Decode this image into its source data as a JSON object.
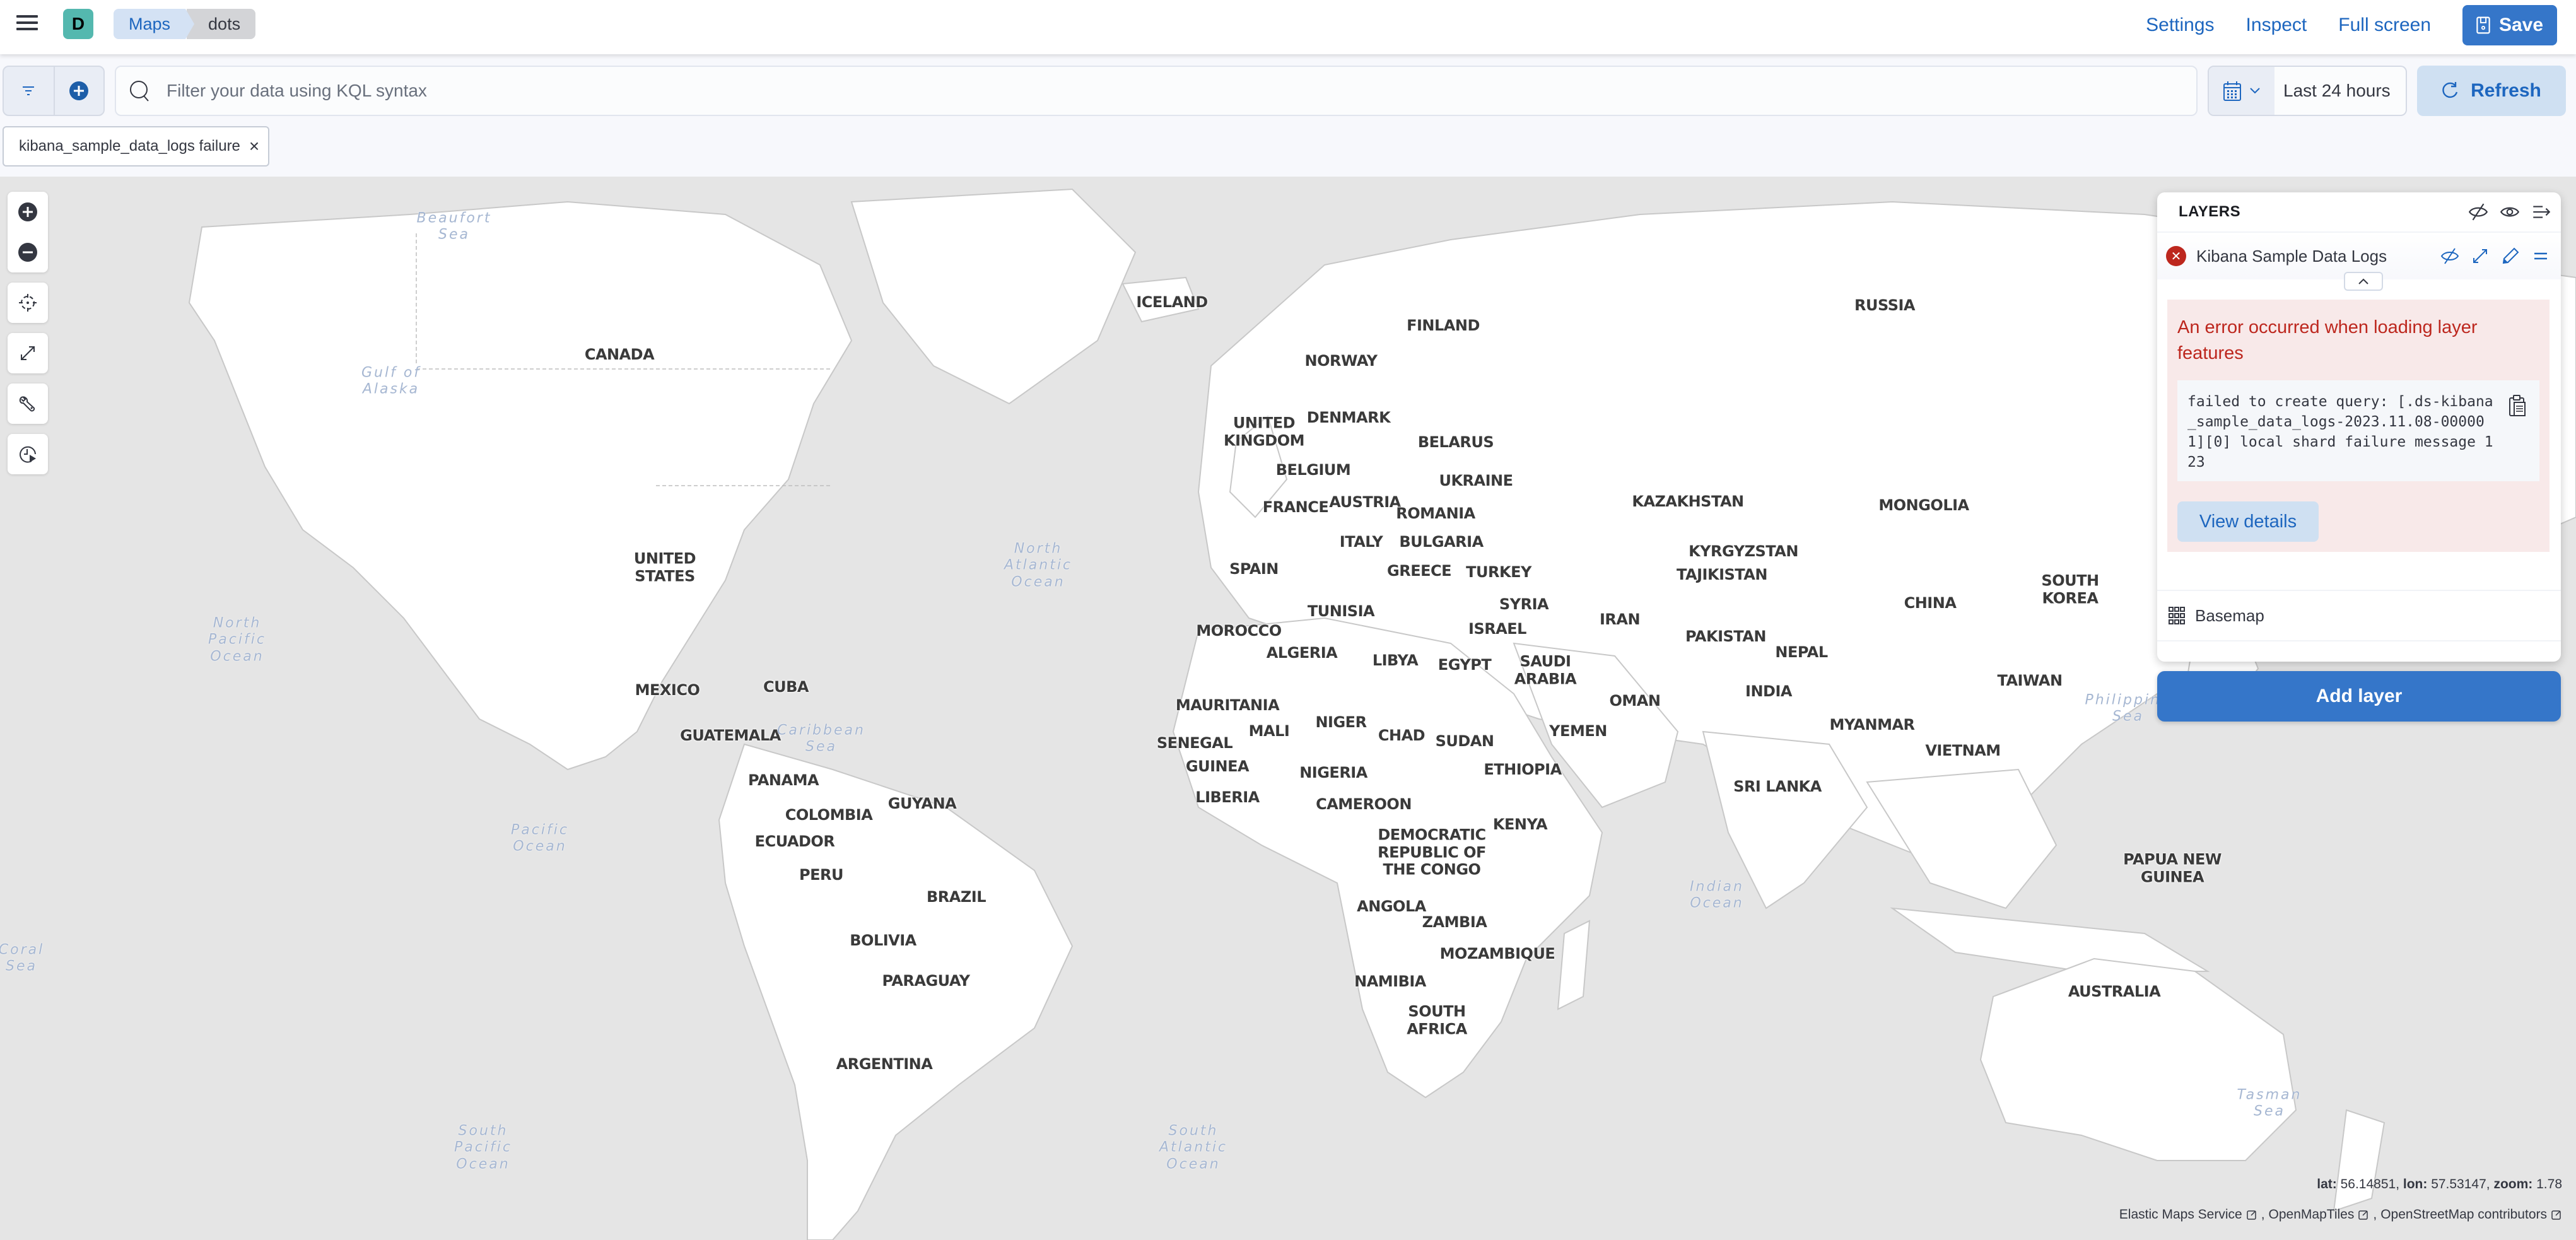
{
  "header": {
    "avatar_initial": "D",
    "breadcrumbs": [
      "Maps",
      "dots"
    ],
    "links": [
      "Settings",
      "Inspect",
      "Full screen"
    ],
    "save_label": "Save"
  },
  "query_bar": {
    "search_placeholder": "Filter your data using KQL syntax",
    "search_value": "",
    "date_range": "Last 24 hours",
    "refresh_label": "Refresh"
  },
  "filters": [
    {
      "label": "kibana_sample_data_logs failure"
    }
  ],
  "layers_panel": {
    "title": "LAYERS",
    "layers": [
      {
        "name": "Kibana Sample Data Logs",
        "status": "error",
        "error_title": "An error occurred when loading layer features",
        "error_message": "failed to create query: [.ds-kibana_sample_data_logs-2023.11.08-000001][0] local shard failure message 123",
        "details_label": "View details"
      },
      {
        "name": "Basemap",
        "status": "ok"
      }
    ],
    "add_layer_label": "Add layer"
  },
  "map": {
    "lat_label": "lat:",
    "lat": "56.14851",
    "lon_label": "lon:",
    "lon": "57.53147",
    "zoom_label": "zoom:",
    "zoom": "1.78",
    "attributions": [
      "Elastic Maps Service",
      "OpenMapTiles",
      "OpenStreetMap contributors"
    ],
    "country_labels": [
      "ICELAND",
      "RUSSIA",
      "CANADA",
      "FINLAND",
      "NORWAY",
      "UNITED KINGDOM",
      "DENMARK",
      "BELARUS",
      "BELGIUM",
      "UKRAINE",
      "FRANCE",
      "AUSTRIA",
      "ROMANIA",
      "KAZAKHSTAN",
      "MONGOLIA",
      "ITALY",
      "BULGARIA",
      "KYRGYZSTAN",
      "TAJIKISTAN",
      "UNITED STATES",
      "SPAIN",
      "GREECE",
      "TURKEY",
      "SOUTH KOREA",
      "CHINA",
      "SYRIA",
      "IRAN",
      "TUNISIA",
      "MOROCCO",
      "ISRAEL",
      "PAKISTAN",
      "ALGERIA",
      "LIBYA",
      "EGYPT",
      "SAUDI ARABIA",
      "NEPAL",
      "MEXICO",
      "INDIA",
      "TAIWAN",
      "CUBA",
      "OMAN",
      "MAURITANIA",
      "MALI",
      "NIGER",
      "CHAD",
      "SUDAN",
      "YEMEN",
      "MYANMAR",
      "GUATEMALA",
      "SENEGAL",
      "VIETNAM",
      "GUINEA",
      "NIGERIA",
      "ETHIOPIA",
      "PANAMA",
      "LIBERIA",
      "SRI LANKA",
      "GUYANA",
      "CAMEROON",
      "COLOMBIA",
      "KENYA",
      "ECUADOR",
      "DEMOCRATIC REPUBLIC OF THE CONGO",
      "PAPUA NEW GUINEA",
      "PERU",
      "BRAZIL",
      "ANGOLA",
      "ZAMBIA",
      "BOLIVIA",
      "MOZAMBIQUE",
      "NAMIBIA",
      "PARAGUAY",
      "AUSTRALIA",
      "SOUTH AFRICA",
      "ARGENTINA"
    ],
    "sea_labels": [
      "Beaufort Sea",
      "Gulf of Alaska",
      "North Atlantic Ocean",
      "North Pacific Ocean",
      "Caribbean Sea",
      "Pacific Ocean",
      "Indian Ocean",
      "Philippine Sea",
      "Coral Sea",
      "South Pacific Ocean",
      "South Atlantic Ocean",
      "Tasman Sea"
    ]
  }
}
